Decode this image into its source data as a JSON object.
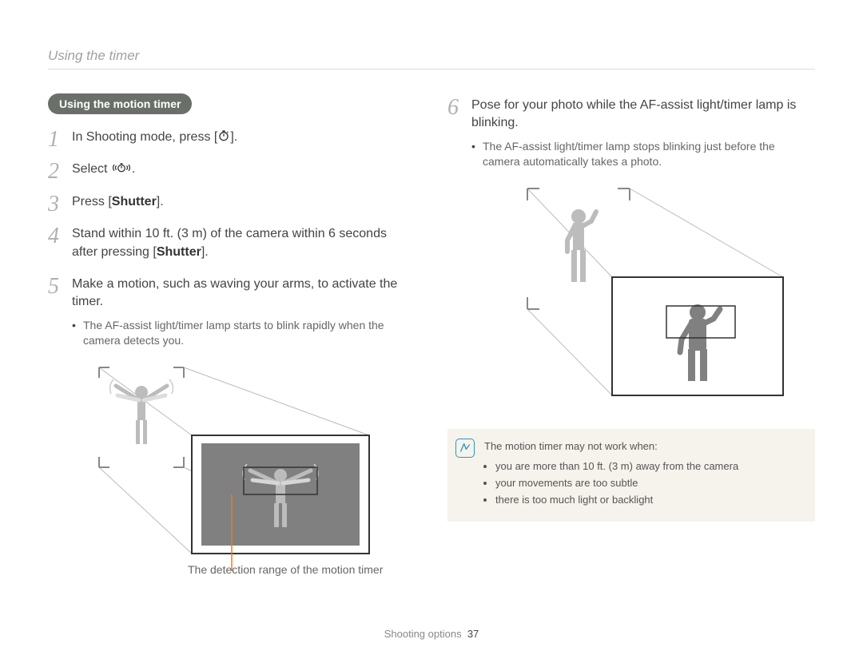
{
  "header": {
    "title": "Using the timer"
  },
  "left": {
    "section_label": "Using the motion timer",
    "steps": {
      "s1": {
        "num": "1",
        "pre": "In Shooting mode, press [",
        "post": "]."
      },
      "s2": {
        "num": "2",
        "pre": "Select ",
        "post": "."
      },
      "s3": {
        "num": "3",
        "pre": "Press [",
        "bold": "Shutter",
        "post": "]."
      },
      "s4": {
        "num": "4",
        "pre": "Stand within 10 ft. (3 m) of the camera within 6 seconds after pressing [",
        "bold": "Shutter",
        "post": "]."
      },
      "s5": {
        "num": "5",
        "text": "Make a motion, such as waving your arms, to activate the timer.",
        "sub": "The AF-assist light/timer lamp starts to blink rapidly when the camera detects you."
      }
    },
    "caption": "The detection range of the motion timer"
  },
  "right": {
    "steps": {
      "s6": {
        "num": "6",
        "text": "Pose for your photo while the AF-assist light/timer lamp is blinking.",
        "sub": "The AF-assist light/timer lamp stops blinking just before the camera automatically takes a photo."
      }
    },
    "note": {
      "head": "The motion timer may not work when:",
      "items": [
        "you are more than 10 ft. (3 m) away from the camera",
        "your movements are too subtle",
        "there is too much light or backlight"
      ]
    }
  },
  "footer": {
    "section": "Shooting options",
    "page": "37"
  }
}
